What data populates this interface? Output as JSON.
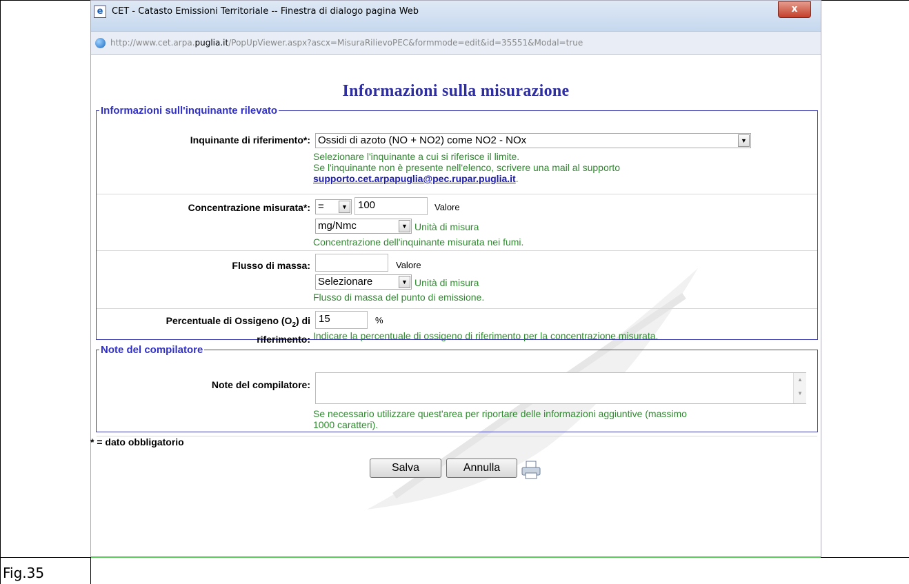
{
  "window": {
    "title": "CET - Catasto Emissioni Territoriale -- Finestra di dialogo pagina Web",
    "close_label": "x",
    "url_prefix": "http://www.cet.arpa.",
    "url_domain": "puglia.it",
    "url_suffix": "/PopUpViewer.aspx?ascx=MisuraRilievoPEC&formmode=edit&id=35551&Modal=true"
  },
  "page": {
    "title": "Informazioni sulla misurazione",
    "fieldset_inquinante": {
      "legend": "Informazioni sull'inquinante rilevato",
      "inquinante": {
        "label": "Inquinante di riferimento*:",
        "selected": "Ossidi di azoto (NO + NO2) come NO2 - NOx",
        "hint1": "Selezionare l'inquinante a cui si riferisce il limite.",
        "hint2": "Se l'inquinante non è presente nell'elenco, scrivere una mail al supporto",
        "email": "supporto.cet.arpapuglia@pec.rupar.puglia.it",
        "email_suffix": "."
      },
      "concentrazione": {
        "label": "Concentrazione misurata*:",
        "operator": "=",
        "value": "100",
        "value_label": "Valore",
        "unit": "mg/Nmc",
        "unit_label": "Unità di misura",
        "hint": "Concentrazione dell'inquinante misurata nei fumi."
      },
      "flusso": {
        "label": "Flusso di massa:",
        "value": "",
        "value_label": "Valore",
        "unit": "Selezionare",
        "unit_label": "Unità di misura",
        "hint": "Flusso di massa del punto di emissione."
      },
      "ossigeno": {
        "label_part1": "Percentuale di Ossigeno (O",
        "label_sub": "2",
        "label_part2": ") di",
        "label_line2": "riferimento:",
        "value": "15",
        "unit": "%",
        "hint": "Indicare la percentuale di ossigeno di riferimento per la concentrazione misurata."
      }
    },
    "fieldset_note": {
      "legend": "Note del compilatore",
      "label": "Note del compilatore:",
      "value": "",
      "hint_line1": "Se necessario utilizzare quest'area per riportare delle informazioni aggiuntive (massimo",
      "hint_line2": "1000 caratteri)."
    },
    "required_note": "* = dato obbligatorio",
    "buttons": {
      "save": "Salva",
      "cancel": "Annulla"
    }
  },
  "caption": "Fig.35",
  "icons": {
    "print": "printer-icon",
    "browser": "ie-icon"
  }
}
